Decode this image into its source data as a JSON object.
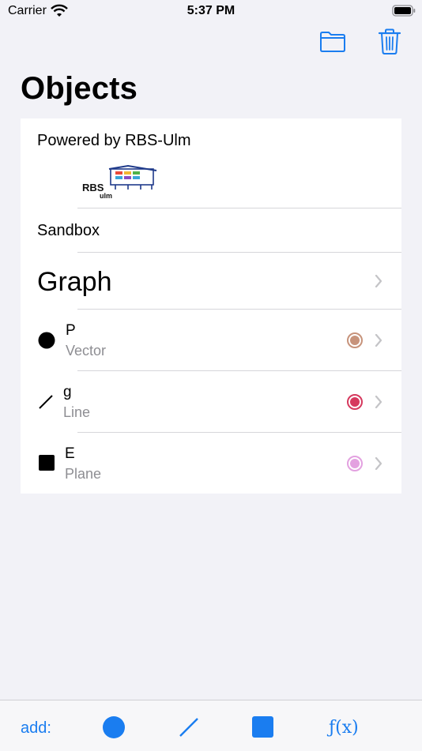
{
  "status_bar": {
    "carrier": "Carrier",
    "time": "5:37 PM"
  },
  "nav": {
    "title": "Objects"
  },
  "card": {
    "powered_by": "Powered by RBS-Ulm",
    "logo_text_main": "RBS",
    "logo_text_sub": "ulm",
    "sandbox_label": "Sandbox",
    "graph_label": "Graph",
    "objects": [
      {
        "name": "P",
        "type": "Vector",
        "symbol": "circle",
        "color": "#c7937b"
      },
      {
        "name": "g",
        "type": "Line",
        "symbol": "line",
        "color": "#d6395e"
      },
      {
        "name": "E",
        "type": "Plane",
        "symbol": "square",
        "color": "#e3a1e0"
      }
    ]
  },
  "toolbar": {
    "add_label": "add:",
    "function_label": "ƒ(x)"
  },
  "accent_color": "#1a7df0"
}
